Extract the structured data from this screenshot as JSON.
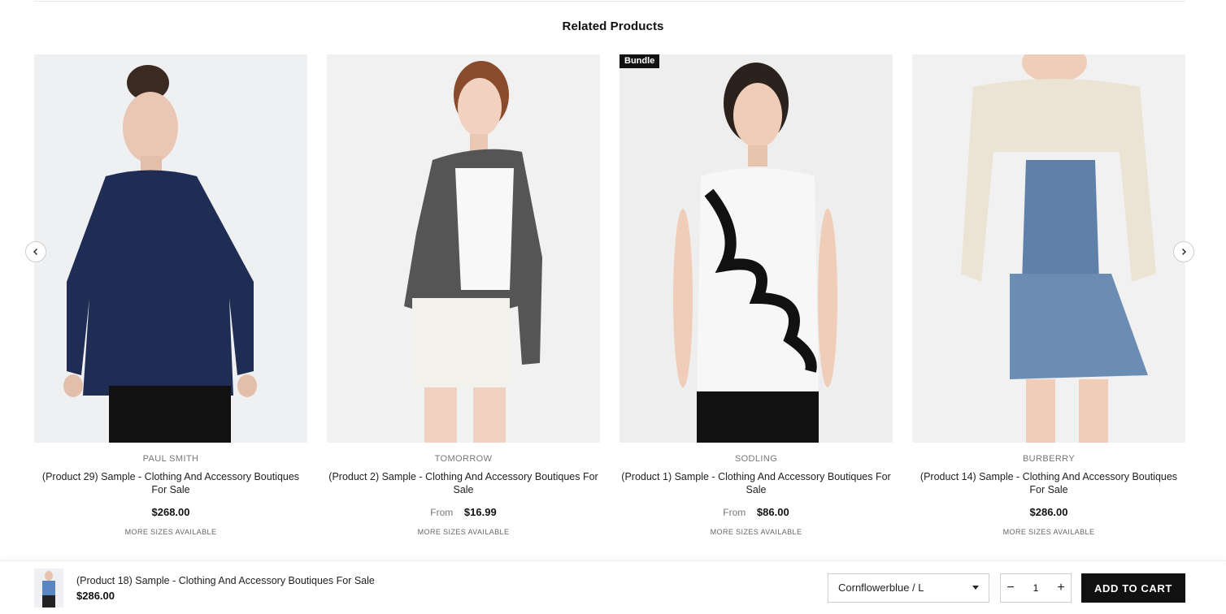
{
  "section": {
    "title": "Related Products"
  },
  "products": [
    {
      "brand": "PAUL SMITH",
      "title": "(Product 29) Sample - Clothing And Accessory Boutiques For Sale",
      "from": "",
      "price": "$268.00",
      "sizes": "MORE SIZES AVAILABLE",
      "badge": ""
    },
    {
      "brand": "TOMORROW",
      "title": "(Product 2) Sample - Clothing And Accessory Boutiques For Sale",
      "from": "From",
      "price": "$16.99",
      "sizes": "MORE SIZES AVAILABLE",
      "badge": ""
    },
    {
      "brand": "SODLING",
      "title": "(Product 1) Sample - Clothing And Accessory Boutiques For Sale",
      "from": "From",
      "price": "$86.00",
      "sizes": "MORE SIZES AVAILABLE",
      "badge": "Bundle"
    },
    {
      "brand": "BURBERRY",
      "title": "(Product 14) Sample - Clothing And Accessory Boutiques For Sale",
      "from": "",
      "price": "$286.00",
      "sizes": "MORE SIZES AVAILABLE",
      "badge": ""
    }
  ],
  "carousel": {
    "prev_icon": "chevron-left-icon",
    "next_icon": "chevron-right-icon"
  },
  "sticky_cart": {
    "title": "(Product 18) Sample - Clothing And Accessory Boutiques For Sale",
    "price": "$286.00",
    "variant": "Cornflowerblue / L",
    "quantity": "1",
    "minus": "−",
    "plus": "+",
    "add_to_cart": "ADD TO CART"
  },
  "colors": {
    "button_bg": "#111111",
    "border": "#cfcfcf",
    "image_bg": "#f2f2f3"
  }
}
